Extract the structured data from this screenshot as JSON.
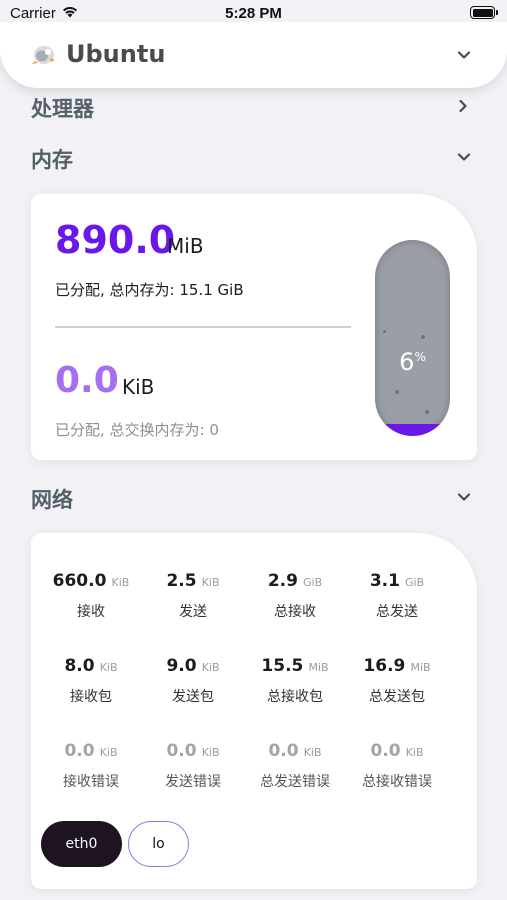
{
  "status_bar": {
    "carrier": "Carrier",
    "time": "5:28 PM"
  },
  "header": {
    "title": "Ubuntu",
    "logo_icon": "ubuntu-logo-icon"
  },
  "sections": {
    "processor": "处理器",
    "memory": "内存",
    "network": "网络"
  },
  "memory": {
    "ram_value": "890.0",
    "ram_unit": "MiB",
    "ram_desc": "已分配, 总内存为: 15.1 GiB",
    "swap_value": "0.0",
    "swap_unit": "KiB",
    "swap_desc": "已分配, 总交换内存为: 0",
    "gauge_percent": "6",
    "gauge_symbol": "%",
    "gauge_fraction": 0.06,
    "colors": {
      "primary": "#6a17ea",
      "secondary": "#a46ff0"
    }
  },
  "network": {
    "stats": [
      {
        "value": "660.0",
        "unit": "KiB",
        "label": "接收"
      },
      {
        "value": "2.5",
        "unit": "KiB",
        "label": "发送"
      },
      {
        "value": "2.9",
        "unit": "GiB",
        "label": "总接收"
      },
      {
        "value": "3.1",
        "unit": "GiB",
        "label": "总发送"
      },
      {
        "value": "8.0",
        "unit": "KiB",
        "label": "接收包"
      },
      {
        "value": "9.0",
        "unit": "KiB",
        "label": "发送包"
      },
      {
        "value": "15.5",
        "unit": "MiB",
        "label": "总接收包"
      },
      {
        "value": "16.9",
        "unit": "MiB",
        "label": "总发送包"
      },
      {
        "value": "0.0",
        "unit": "KiB",
        "label": "接收错误"
      },
      {
        "value": "0.0",
        "unit": "KiB",
        "label": "发送错误"
      },
      {
        "value": "0.0",
        "unit": "KiB",
        "label": "总发送错误"
      },
      {
        "value": "0.0",
        "unit": "KiB",
        "label": "总接收错误"
      }
    ],
    "interfaces": [
      {
        "name": "eth0",
        "selected": true
      },
      {
        "name": "lo",
        "selected": false
      }
    ]
  }
}
